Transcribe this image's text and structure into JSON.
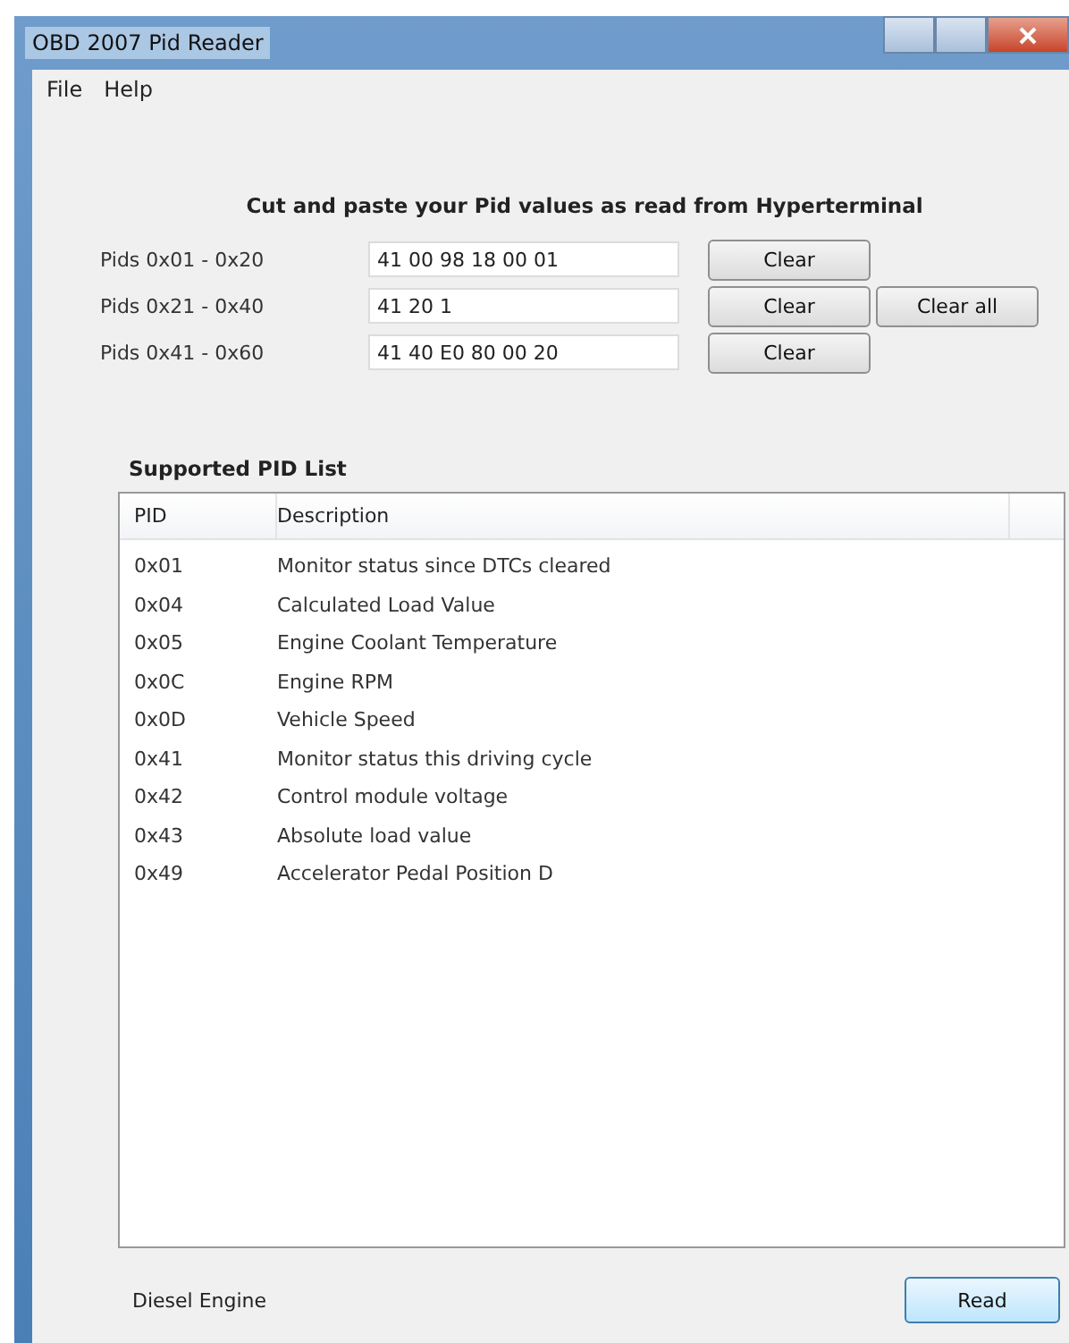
{
  "window": {
    "title": "OBD 2007 Pid Reader"
  },
  "menu": [
    "File",
    "Help"
  ],
  "instruction": "Cut and paste your Pid values as read from Hyperterminal",
  "pid_inputs": [
    {
      "label": "Pids 0x01 - 0x20",
      "value": "41 00 98 18 00 01",
      "button": "Clear"
    },
    {
      "label": "Pids 0x21 - 0x40",
      "value": "41 20 1",
      "button": "Clear"
    },
    {
      "label": "Pids 0x41 - 0x60",
      "value": "41 40 E0 80 00 20",
      "button": "Clear"
    }
  ],
  "clear_all_button": "Clear all",
  "pid_list": {
    "title": "Supported PID List",
    "columns": [
      "PID",
      "Description"
    ],
    "rows": [
      [
        "0x01",
        "Monitor status since DTCs cleared"
      ],
      [
        "0x04",
        "Calculated Load Value"
      ],
      [
        "0x05",
        "Engine Coolant Temperature"
      ],
      [
        "0x0C",
        "Engine RPM"
      ],
      [
        "0x0D",
        "Vehicle Speed"
      ],
      [
        "0x41",
        "Monitor status this driving cycle"
      ],
      [
        "0x42",
        "Control module voltage"
      ],
      [
        "0x43",
        "Absolute load value"
      ],
      [
        "0x49",
        "Accelerator Pedal Position D"
      ]
    ]
  },
  "engine_type": "Diesel Engine",
  "read_button": "Read"
}
